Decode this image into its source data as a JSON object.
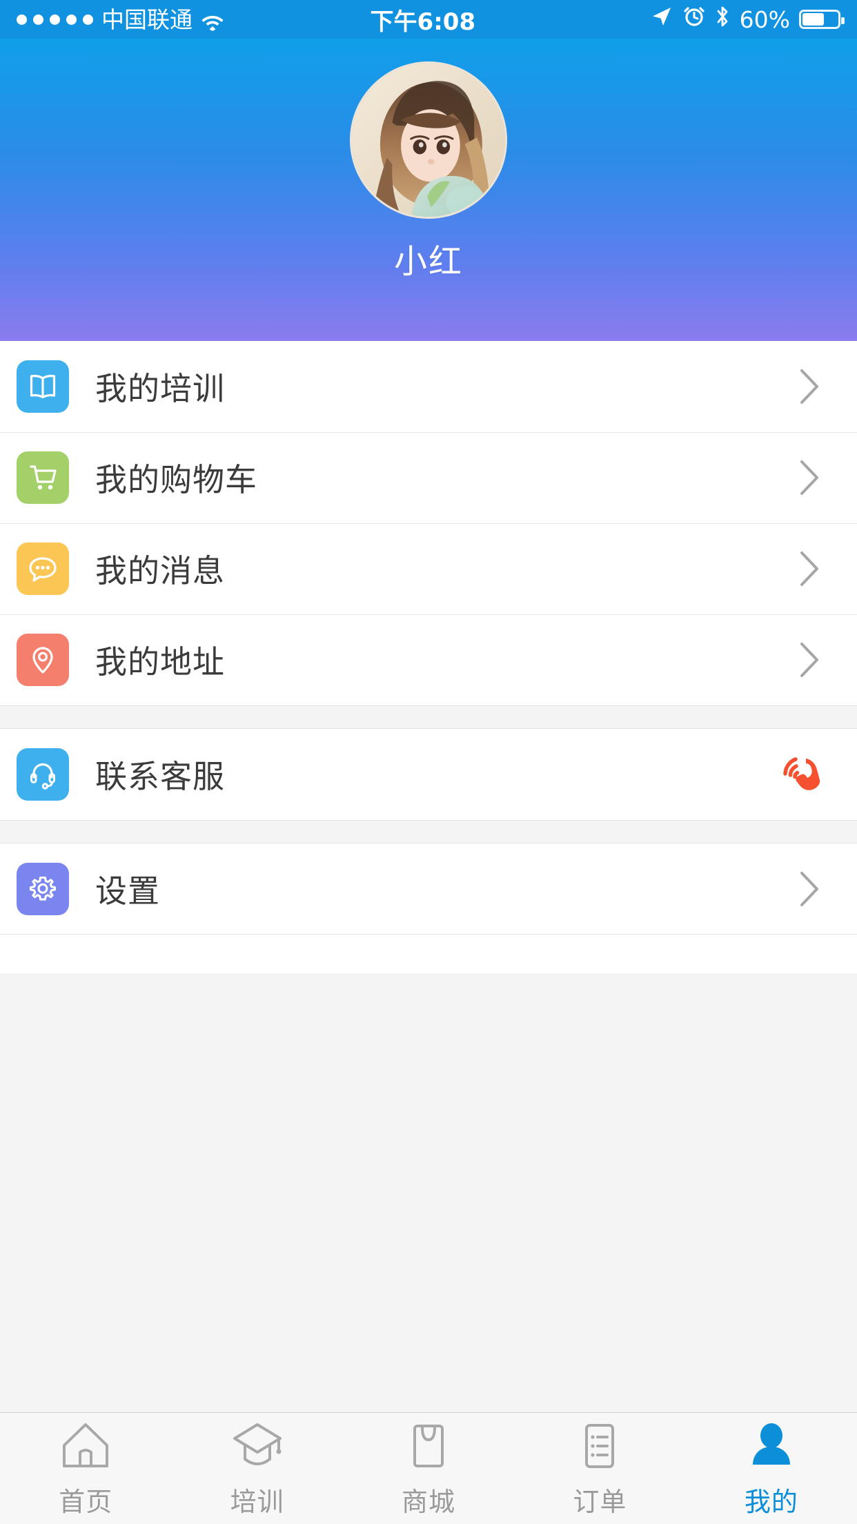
{
  "status_bar": {
    "signal_dots": 5,
    "carrier": "中国联通",
    "wifi_icon": "wifi-icon",
    "time": "下午6:08",
    "location_icon": "location-arrow-icon",
    "alarm_icon": "alarm-clock-icon",
    "bluetooth_icon": "bluetooth-icon",
    "battery_percent": "60%",
    "battery_level": 60,
    "background_color": "#1192e0",
    "foreground_color": "#ffffff"
  },
  "header": {
    "username": "小红",
    "avatar_name": "user-avatar",
    "gradient_from": "#0f9fe9",
    "gradient_to": "#8b7cee"
  },
  "menu": {
    "groups": [
      {
        "items": [
          {
            "label": "我的培训",
            "icon": "book-icon",
            "icon_color": "#3fb0ee",
            "accessory": "chevron-right-icon"
          },
          {
            "label": "我的购物车",
            "icon": "shopping-cart-icon",
            "icon_color": "#a4d06a",
            "accessory": "chevron-right-icon"
          },
          {
            "label": "我的消息",
            "icon": "chat-bubble-icon",
            "icon_color": "#fbc košt54",
            "accessory": "chevron-right-icon"
          },
          {
            "label": "我的地址",
            "icon": "map-pin-icon",
            "icon_color": "#f57f6d",
            "accessory": "chevron-right-icon"
          }
        ]
      },
      {
        "items": [
          {
            "label": "联系客服",
            "icon": "headset-icon",
            "icon_color": "#3fb0ee",
            "accessory": "phone-call-icon",
            "accessory_color": "#f5502f"
          }
        ]
      },
      {
        "items": [
          {
            "label": "设置",
            "icon": "gear-icon",
            "icon_color": "#7b85ef",
            "accessory": "chevron-right-icon"
          }
        ]
      }
    ]
  },
  "tabbar": {
    "active_color": "#0c8fd8",
    "inactive_color": "#9a9a9a",
    "tabs": [
      {
        "label": "首页",
        "icon": "home-icon",
        "active": false
      },
      {
        "label": "培训",
        "icon": "graduation-cap-icon",
        "active": false
      },
      {
        "label": "商城",
        "icon": "shopping-bag-icon",
        "active": false
      },
      {
        "label": "订单",
        "icon": "order-list-icon",
        "active": false
      },
      {
        "label": "我的",
        "icon": "person-icon",
        "active": true
      }
    ]
  }
}
